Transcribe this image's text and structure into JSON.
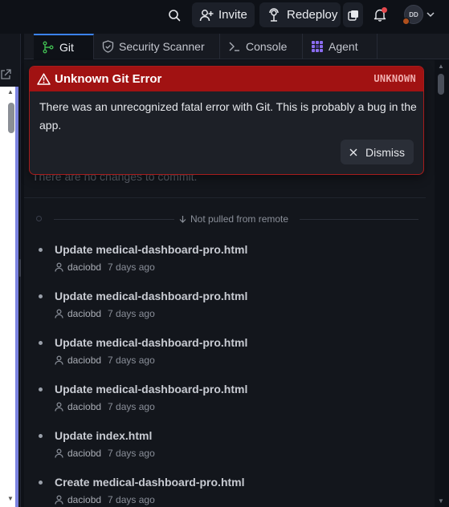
{
  "topbar": {
    "invite_label": "Invite",
    "redeploy_label": "Redeploy",
    "avatar_initials": "DD"
  },
  "tabs": [
    {
      "label": "Git",
      "icon": "git-branch-icon",
      "active": true
    },
    {
      "label": "Security Scanner",
      "icon": "shield-icon",
      "active": false
    },
    {
      "label": "Console",
      "icon": "terminal-icon",
      "active": false
    },
    {
      "label": "Agent",
      "icon": "agent-icon",
      "active": false
    }
  ],
  "error": {
    "title": "Unknown Git Error",
    "code": "UNKNOWN",
    "message": "There was an unrecognized fatal error with Git. This is probably a bug in the app.",
    "dismiss_label": "Dismiss"
  },
  "status": {
    "no_changes": "There are no changes to commit."
  },
  "remote_separator": "Not pulled from remote",
  "commits": [
    {
      "message": "Update medical-dashboard-pro.html",
      "author": "daciobd",
      "time": "7 days ago"
    },
    {
      "message": "Update medical-dashboard-pro.html",
      "author": "daciobd",
      "time": "7 days ago"
    },
    {
      "message": "Update medical-dashboard-pro.html",
      "author": "daciobd",
      "time": "7 days ago"
    },
    {
      "message": "Update medical-dashboard-pro.html",
      "author": "daciobd",
      "time": "7 days ago"
    },
    {
      "message": "Update index.html",
      "author": "daciobd",
      "time": "7 days ago"
    },
    {
      "message": "Create medical-dashboard-pro.html",
      "author": "daciobd",
      "time": "7 days ago"
    }
  ],
  "colors": {
    "background": "#0e1117",
    "error_header": "#a11212",
    "accent_tab": "#3b82f6",
    "left_accent": "#7b83e0"
  }
}
